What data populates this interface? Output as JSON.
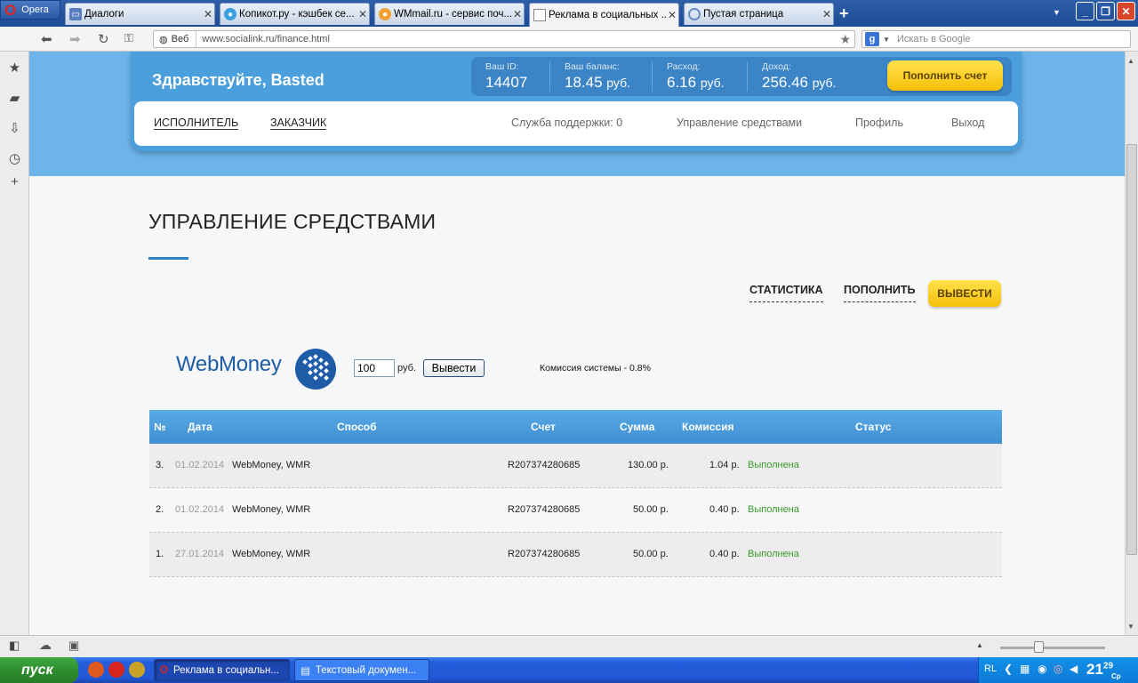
{
  "browser": {
    "opera_label": "Opera",
    "tabs": [
      {
        "label": "Диалоги"
      },
      {
        "label": "Копикот.ру - кэшбек се..."
      },
      {
        "label": "WMmail.ru - сервис поч..."
      },
      {
        "label": "Реклама в социальных ..."
      },
      {
        "label": "Пустая страница"
      }
    ],
    "address": {
      "scheme_label": "Веб",
      "url": "www.socialink.ru/finance.html"
    },
    "search": {
      "engine": "g",
      "placeholder": "Искать в Google"
    }
  },
  "header": {
    "greeting": "Здравствуйте, Basted",
    "stats": [
      {
        "label": "Ваш ID:",
        "value": "14407",
        "unit": ""
      },
      {
        "label": "Ваш баланс:",
        "value": "18.45",
        "unit": "руб."
      },
      {
        "label": "Расход:",
        "value": "6.16",
        "unit": "руб."
      },
      {
        "label": "Доход:",
        "value": "256.46",
        "unit": "руб."
      }
    ],
    "topup_label": "Пополнить счет",
    "nav": {
      "performer": "ИСПОЛНИТЕЛЬ",
      "customer": "ЗАКАЗЧИК",
      "support": "Служба поддержки: 0",
      "funds": "Управление средствами",
      "profile": "Профиль",
      "logout": "Выход"
    }
  },
  "page": {
    "title": "УПРАВЛЕНИЕ СРЕДСТВАМИ",
    "subnav": {
      "stats": "СТАТИСТИКА",
      "topup": "ПОПОЛНИТЬ",
      "withdraw": "ВЫВЕСТИ"
    }
  },
  "withdraw_form": {
    "brand": "WebMoney",
    "amount_value": "100",
    "currency": "руб.",
    "button_label": "Вывести",
    "fee_note": "Комиссия системы - 0.8%"
  },
  "table": {
    "headers": {
      "num": "№",
      "date": "Дата",
      "method": "Способ",
      "account": "Счет",
      "sum": "Сумма",
      "fee": "Комиссия",
      "status": "Статус"
    },
    "rows": [
      {
        "num": "3.",
        "date": "01.02.2014",
        "method": "WebMoney, WMR",
        "account": "R207374280685",
        "sum": "130.00 р.",
        "fee": "1.04 р.",
        "status": "Выполнена"
      },
      {
        "num": "2.",
        "date": "01.02.2014",
        "method": "WebMoney, WMR",
        "account": "R207374280685",
        "sum": "50.00 р.",
        "fee": "0.40 р.",
        "status": "Выполнена"
      },
      {
        "num": "1.",
        "date": "27.01.2014",
        "method": "WebMoney, WMR",
        "account": "R207374280685",
        "sum": "50.00 р.",
        "fee": "0.40 р.",
        "status": "Выполнена"
      }
    ]
  },
  "taskbar": {
    "start_label": "пуск",
    "items": [
      {
        "label": "Реклама в социальн..."
      },
      {
        "label": "Текстовый докумен..."
      }
    ],
    "lang": "RL",
    "clock": "21",
    "clock_min": "29",
    "clock_day": "Ср"
  },
  "colors": {
    "accent_blue": "#4a9fdc",
    "yellow_button": "#f5bf0a",
    "status_ok": "#3a9a2a"
  }
}
